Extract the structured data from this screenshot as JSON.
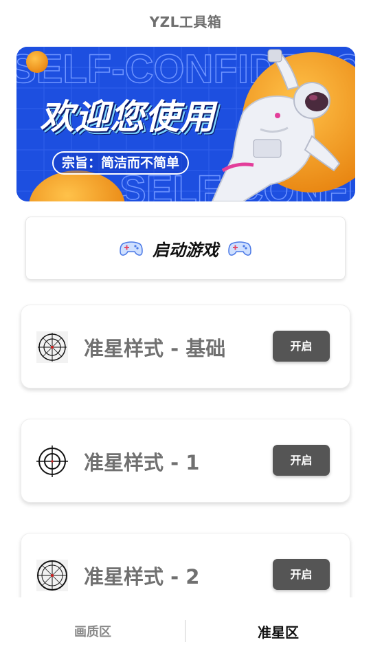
{
  "header": {
    "title": "YZL工具箱"
  },
  "banner": {
    "title": "欢迎您使用",
    "tagline": "宗旨：简洁而不简单",
    "background_text": "SELF-CONFIDENCE"
  },
  "launch": {
    "label": "启动游戏",
    "icon": "gamepad-icon"
  },
  "crosshairs": [
    {
      "label": "准星样式 - 基础",
      "button": "开启",
      "icon": "crosshair-basic-icon"
    },
    {
      "label": "准星样式 - 1",
      "button": "开启",
      "icon": "crosshair-1-icon"
    },
    {
      "label": "准星样式 - 2",
      "button": "开启",
      "icon": "crosshair-2-icon"
    }
  ],
  "nav": {
    "tabs": [
      {
        "label": "画质区",
        "active": false
      },
      {
        "label": "准星区",
        "active": true
      }
    ]
  },
  "colors": {
    "banner_blue": "#1d4fe0",
    "button_gray": "#555555",
    "orange": "#f59a1b"
  }
}
